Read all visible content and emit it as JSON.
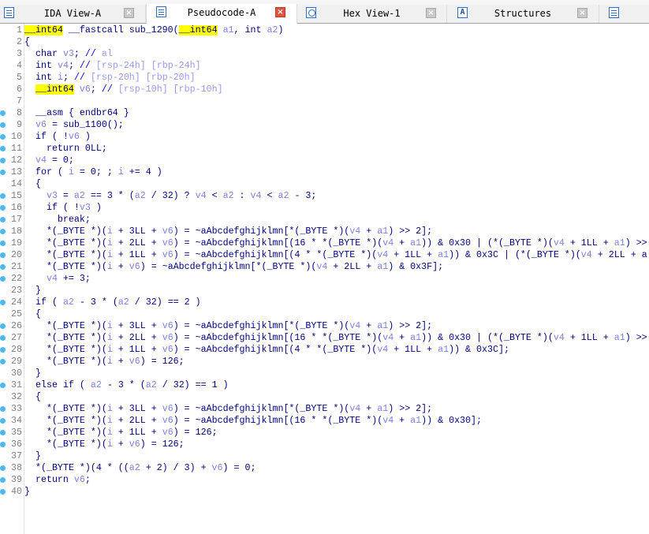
{
  "tabs": [
    {
      "label": "IDA View-A",
      "icon": "disassembly-icon",
      "active": false
    },
    {
      "label": "Pseudocode-A",
      "icon": "pseudocode-icon",
      "active": true
    },
    {
      "label": "Hex View-1",
      "icon": "hex-icon",
      "active": false
    },
    {
      "label": "Structures",
      "icon": "structures-icon",
      "active": false
    },
    {
      "label": "",
      "icon": "enums-icon",
      "active": false
    }
  ],
  "colors": {
    "keyword": "#000080",
    "variable": "#8080e8",
    "highlight": "#ffff00",
    "comment": "#0000ff",
    "breakpoint_dot": "#4db8f0"
  },
  "highlighted_token": "__int64",
  "variables": [
    "a1",
    "a2",
    "v3",
    "v4",
    "v6",
    "i"
  ],
  "code": [
    {
      "n": "1",
      "dot": false,
      "text": "__int64 __fastcall sub_1290(__int64 a1, int a2)"
    },
    {
      "n": "2",
      "dot": false,
      "text": "{"
    },
    {
      "n": "3",
      "dot": false,
      "text": "  char v3; // al"
    },
    {
      "n": "4",
      "dot": false,
      "text": "  int v4; // [rsp-24h] [rbp-24h]"
    },
    {
      "n": "5",
      "dot": false,
      "text": "  int i; // [rsp-20h] [rbp-20h]"
    },
    {
      "n": "6",
      "dot": false,
      "text": "  __int64 v6; // [rsp-10h] [rbp-10h]"
    },
    {
      "n": "7",
      "dot": false,
      "text": ""
    },
    {
      "n": "8",
      "dot": true,
      "text": "  __asm { endbr64 }"
    },
    {
      "n": "9",
      "dot": true,
      "text": "  v6 = sub_1100();"
    },
    {
      "n": "10",
      "dot": true,
      "text": "  if ( !v6 )"
    },
    {
      "n": "11",
      "dot": true,
      "text": "    return 0LL;"
    },
    {
      "n": "12",
      "dot": true,
      "text": "  v4 = 0;"
    },
    {
      "n": "13",
      "dot": true,
      "text": "  for ( i = 0; ; i += 4 )"
    },
    {
      "n": "14",
      "dot": false,
      "text": "  {"
    },
    {
      "n": "15",
      "dot": true,
      "text": "    v3 = a2 == 3 * (a2 / 32) ? v4 < a2 : v4 < a2 - 3;"
    },
    {
      "n": "16",
      "dot": true,
      "text": "    if ( !v3 )"
    },
    {
      "n": "17",
      "dot": true,
      "text": "      break;"
    },
    {
      "n": "18",
      "dot": true,
      "text": "    *(_BYTE *)(i + 3LL + v6) = ~aAbcdefghijklmn[*(_BYTE *)(v4 + a1) >> 2];"
    },
    {
      "n": "19",
      "dot": true,
      "text": "    *(_BYTE *)(i + 2LL + v6) = ~aAbcdefghijklmn[(16 * *(_BYTE *)(v4 + a1)) & 0x30 | (*(_BYTE *)(v4 + 1LL + a1) >>"
    },
    {
      "n": "20",
      "dot": true,
      "text": "    *(_BYTE *)(i + 1LL + v6) = ~aAbcdefghijklmn[(4 * *(_BYTE *)(v4 + 1LL + a1)) & 0x3C | (*(_BYTE *)(v4 + 2LL + a"
    },
    {
      "n": "21",
      "dot": true,
      "text": "    *(_BYTE *)(i + v6) = ~aAbcdefghijklmn[*(_BYTE *)(v4 + 2LL + a1) & 0x3F];"
    },
    {
      "n": "22",
      "dot": true,
      "text": "    v4 += 3;"
    },
    {
      "n": "23",
      "dot": false,
      "text": "  }"
    },
    {
      "n": "24",
      "dot": true,
      "text": "  if ( a2 - 3 * (a2 / 32) == 2 )"
    },
    {
      "n": "25",
      "dot": false,
      "text": "  {"
    },
    {
      "n": "26",
      "dot": true,
      "text": "    *(_BYTE *)(i + 3LL + v6) = ~aAbcdefghijklmn[*(_BYTE *)(v4 + a1) >> 2];"
    },
    {
      "n": "27",
      "dot": true,
      "text": "    *(_BYTE *)(i + 2LL + v6) = ~aAbcdefghijklmn[(16 * *(_BYTE *)(v4 + a1)) & 0x30 | (*(_BYTE *)(v4 + 1LL + a1) >>"
    },
    {
      "n": "28",
      "dot": true,
      "text": "    *(_BYTE *)(i + 1LL + v6) = ~aAbcdefghijklmn[(4 * *(_BYTE *)(v4 + 1LL + a1)) & 0x3C];"
    },
    {
      "n": "29",
      "dot": true,
      "text": "    *(_BYTE *)(i + v6) = 126;"
    },
    {
      "n": "30",
      "dot": false,
      "text": "  }"
    },
    {
      "n": "31",
      "dot": true,
      "text": "  else if ( a2 - 3 * (a2 / 32) == 1 )"
    },
    {
      "n": "32",
      "dot": false,
      "text": "  {"
    },
    {
      "n": "33",
      "dot": true,
      "text": "    *(_BYTE *)(i + 3LL + v6) = ~aAbcdefghijklmn[*(_BYTE *)(v4 + a1) >> 2];"
    },
    {
      "n": "34",
      "dot": true,
      "text": "    *(_BYTE *)(i + 2LL + v6) = ~aAbcdefghijklmn[(16 * *(_BYTE *)(v4 + a1)) & 0x30];"
    },
    {
      "n": "35",
      "dot": true,
      "text": "    *(_BYTE *)(i + 1LL + v6) = 126;"
    },
    {
      "n": "36",
      "dot": true,
      "text": "    *(_BYTE *)(i + v6) = 126;"
    },
    {
      "n": "37",
      "dot": false,
      "text": "  }"
    },
    {
      "n": "38",
      "dot": true,
      "text": "  *(_BYTE *)(4 * ((a2 + 2) / 3) + v6) = 0;"
    },
    {
      "n": "39",
      "dot": true,
      "text": "  return v6;"
    },
    {
      "n": "40",
      "dot": true,
      "text": "}"
    }
  ]
}
